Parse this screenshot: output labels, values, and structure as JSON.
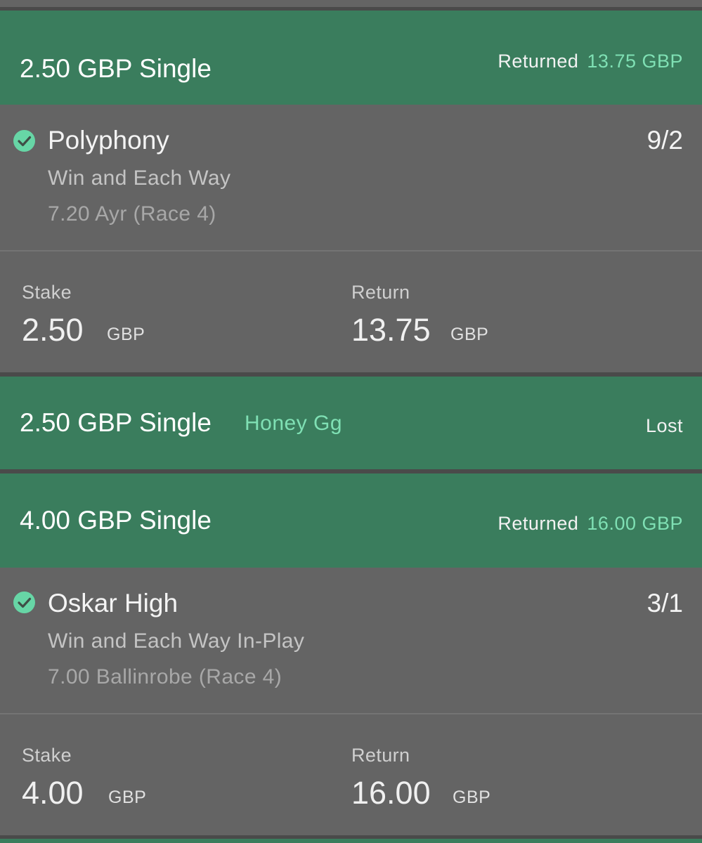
{
  "bets": [
    {
      "header": {
        "title": "2.50 GBP Single",
        "returned_label": "Returned",
        "returned_amount": "13.75 GBP"
      },
      "selection": {
        "name": "Polyphony",
        "odds": "9/2",
        "market": "Win and Each Way",
        "event": "7.20 Ayr (Race 4)",
        "status_icon": "check-circle-icon"
      },
      "stake": {
        "label": "Stake",
        "value": "2.50",
        "currency": "GBP"
      },
      "return": {
        "label": "Return",
        "value": "13.75",
        "currency": "GBP"
      }
    },
    {
      "header": {
        "title": "2.50 GBP Single",
        "selection_name": "Honey Gg",
        "result": "Lost"
      }
    },
    {
      "header": {
        "title": "4.00 GBP Single",
        "returned_label": "Returned",
        "returned_amount": "16.00 GBP"
      },
      "selection": {
        "name": "Oskar High",
        "odds": "3/1",
        "market": "Win and Each Way In-Play",
        "event": "7.00 Ballinrobe (Race 4)",
        "status_icon": "check-circle-icon"
      },
      "stake": {
        "label": "Stake",
        "value": "4.00",
        "currency": "GBP"
      },
      "return": {
        "label": "Return",
        "value": "16.00",
        "currency": "GBP"
      }
    }
  ],
  "colors": {
    "header_green": "#3a7d5d",
    "panel_grey": "#646464",
    "accent_mint": "#7fe0b4",
    "check_green": "#67d6a6"
  }
}
